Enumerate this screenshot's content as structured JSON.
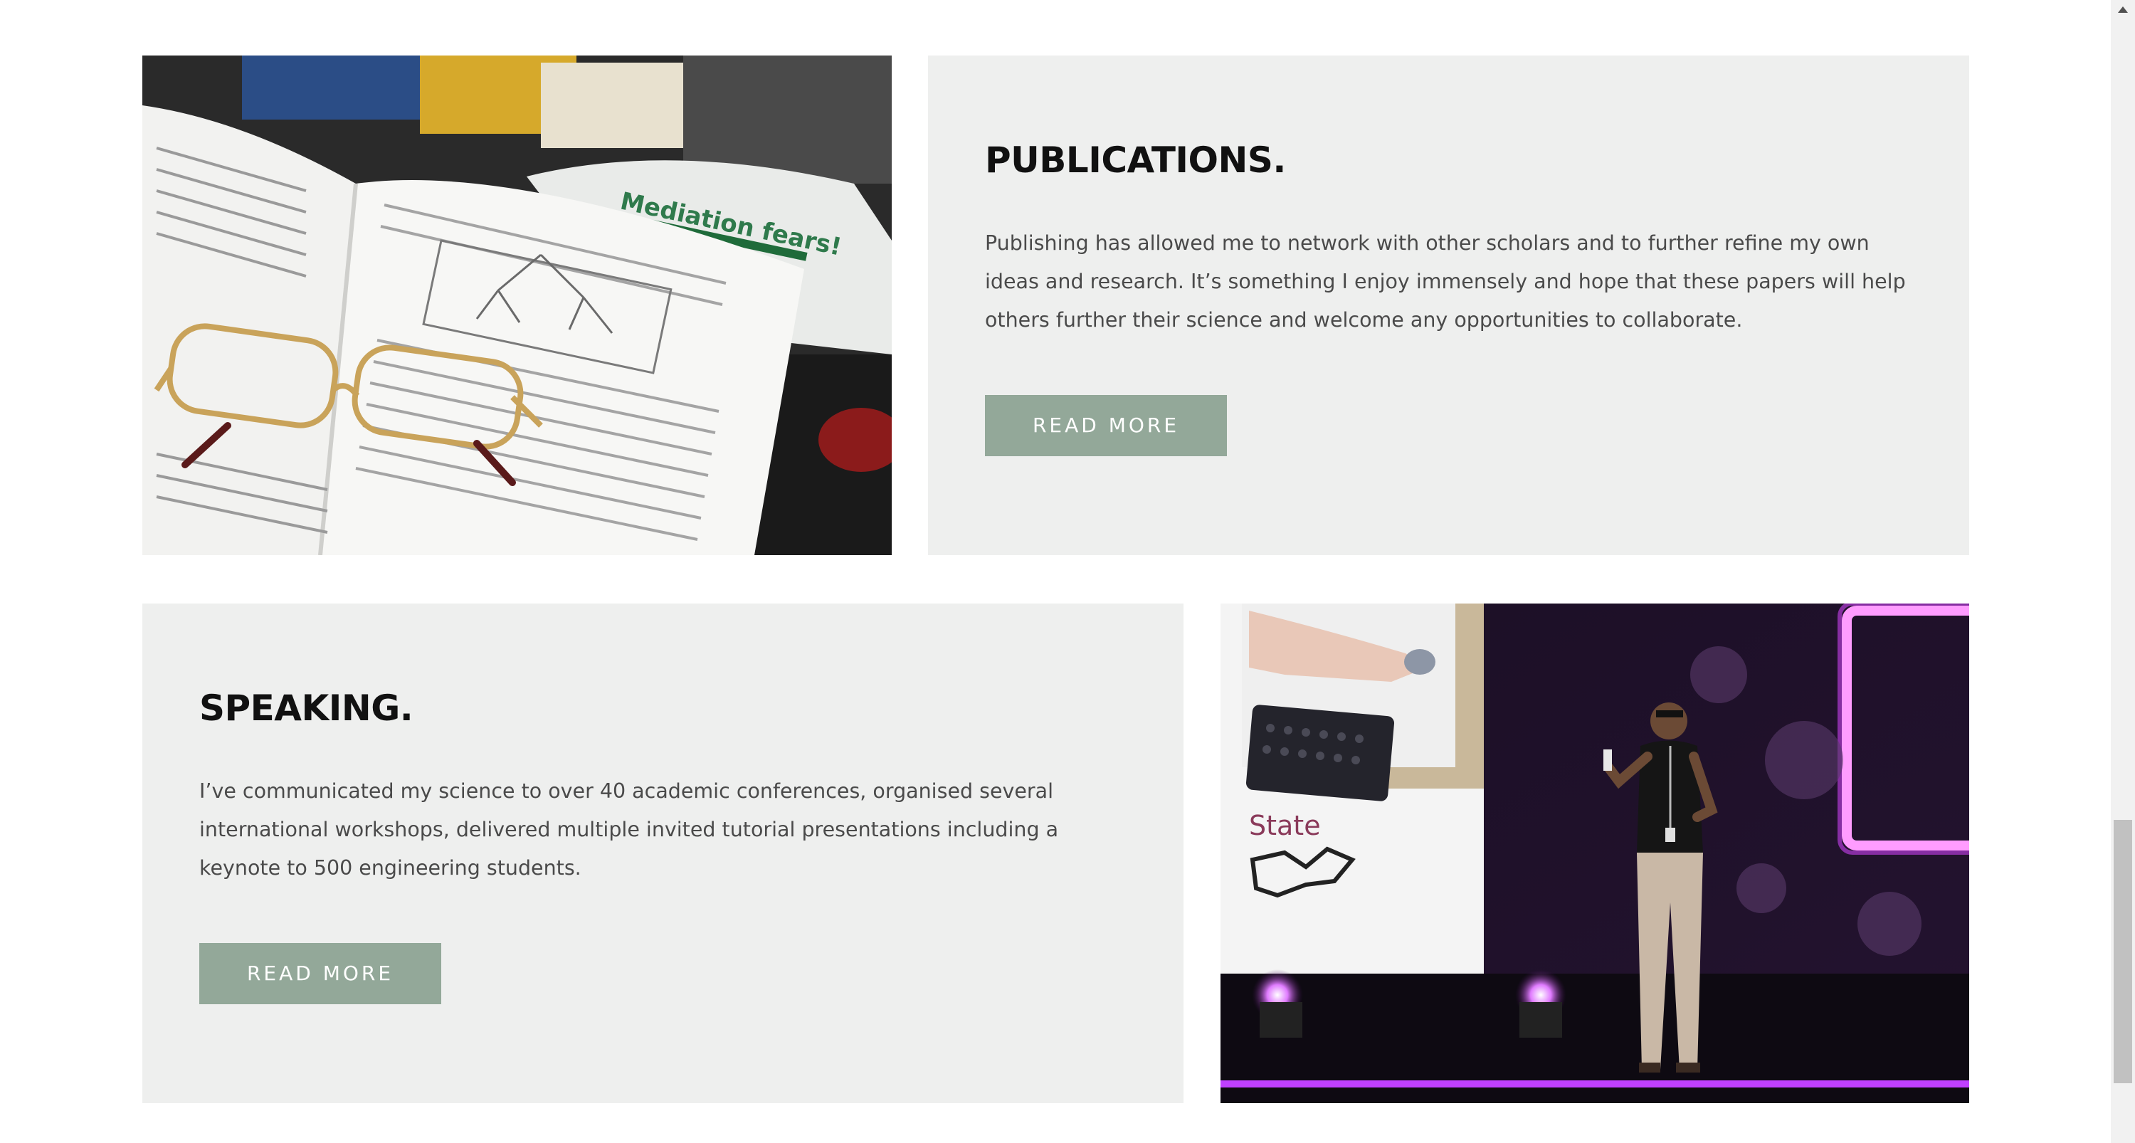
{
  "sections": {
    "publications": {
      "title": "PUBLICATIONS.",
      "body": "Publishing has allowed me to network with other scholars and to further refine my own ideas and research. It’s something I enjoy immensely and hope that these papers will help others further their science and welcome any opportunities to collaborate.",
      "button_label": "READ MORE",
      "image_caption": "Mediation fears!"
    },
    "speaking": {
      "title": "SPEAKING.",
      "body": "I’ve communicated my science to over 40 academic conferences, organised several international workshops, delivered multiple invited tutorial presentations including a keynote to 500 engineering students.",
      "button_label": "READ MORE",
      "image_caption": "State"
    }
  },
  "colors": {
    "card_background": "#eeefee",
    "button_background": "#93a899",
    "button_text": "#ffffff",
    "heading": "#111111",
    "body_text": "#4a4a4a"
  },
  "icons": {
    "scroll_up": "triangle-up-icon"
  }
}
